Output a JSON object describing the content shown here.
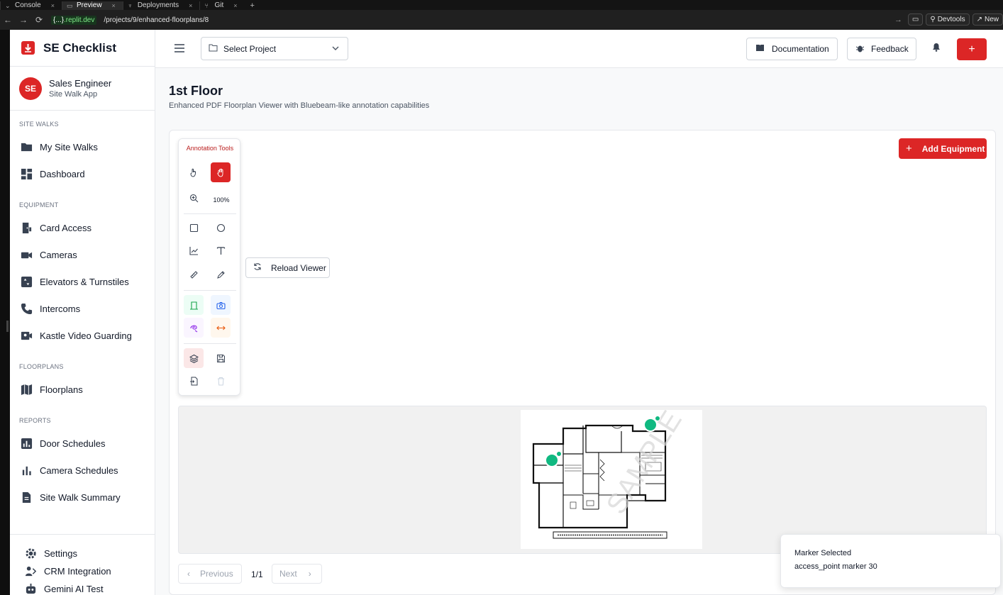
{
  "browser": {
    "tabs": [
      {
        "label": "Console",
        "active": false
      },
      {
        "label": "Preview",
        "active": true
      },
      {
        "label": "Deployments",
        "active": false
      },
      {
        "label": "Git",
        "active": false
      }
    ],
    "url_host_prefix": "{...}",
    "url_host_suffix": ".replit.dev",
    "url_path": "/projects/9/enhanced-floorplans/8",
    "devtools_label": "Devtools",
    "new_label": "New"
  },
  "sidebar": {
    "brand": "SE Checklist",
    "user": {
      "initials": "SE",
      "name": "Sales Engineer",
      "subtitle": "Site Walk App"
    },
    "sections": {
      "site_walks": "SITE WALKS",
      "equipment": "EQUIPMENT",
      "floorplans": "FLOORPLANS",
      "reports": "REPORTS"
    },
    "items": {
      "my_site_walks": "My Site Walks",
      "dashboard": "Dashboard",
      "card_access": "Card Access",
      "cameras": "Cameras",
      "elevators": "Elevators & Turnstiles",
      "intercoms": "Intercoms",
      "kastle": "Kastle Video Guarding",
      "floorplans": "Floorplans",
      "door_schedules": "Door Schedules",
      "camera_schedules": "Camera Schedules",
      "site_walk_summary": "Site Walk Summary"
    },
    "bottom": {
      "settings": "Settings",
      "crm": "CRM Integration",
      "gemini": "Gemini AI Test"
    }
  },
  "header": {
    "project_select": "Select Project",
    "documentation": "Documentation",
    "feedback": "Feedback",
    "plus": "+"
  },
  "page": {
    "title": "1st Floor",
    "subtitle": "Enhanced PDF Floorplan Viewer with Bluebeam-like annotation capabilities",
    "add_equipment": "Add Equipment",
    "reload_viewer": "Reload Viewer"
  },
  "annotation_tools": {
    "title": "Annotation Tools",
    "zoom": "100%",
    "active_tool": "pan"
  },
  "floorplan": {
    "watermark": "SAMPLE",
    "markers": 2
  },
  "pager": {
    "previous": "Previous",
    "page": "1/1",
    "next": "Next"
  },
  "toast": {
    "title": "Marker Selected",
    "message": "access_point marker 30"
  },
  "colors": {
    "brand": "#dc2626",
    "marker": "#10b981"
  }
}
